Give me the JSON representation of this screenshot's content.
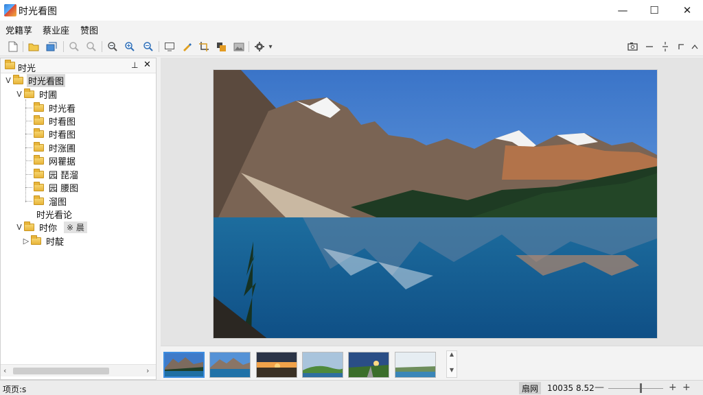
{
  "app": {
    "title": "时光看图"
  },
  "window_controls": {
    "minimize": "—",
    "maximize": "☐",
    "close": "✕"
  },
  "menu": [
    "党籍莩",
    "蔡业座",
    "赞图"
  ],
  "toolbar": {
    "icons": [
      "new-file-icon",
      "open-folder-icon",
      "open-3d-icon",
      "zoom-icon",
      "search-icon",
      "zoom-out-icon",
      "zoom-in-icon",
      "zoom-fit-icon",
      "fit-window-icon",
      "pen-icon",
      "crop-icon",
      "color-icon",
      "gallery-icon",
      "settings-icon"
    ],
    "dropdown": "▾",
    "right_icons": [
      "screenshot-icon",
      "minus-icon",
      "split-icon",
      "corner-icon",
      "collapse-icon"
    ]
  },
  "panel": {
    "title": "时光",
    "pin": "⊥",
    "close": "✕"
  },
  "tree": {
    "root": {
      "toggle": "V",
      "label": "时光看图"
    },
    "folder1": {
      "toggle": "V",
      "label": "时圃"
    },
    "children": [
      "时光看",
      "时看图",
      "时看图",
      "时涨圃",
      "网瞿据",
      "园 琵溜",
      "园 腰图",
      "溜图"
    ],
    "loose_item": "时光看论",
    "folder2": {
      "toggle": "V",
      "label": "时你",
      "tag": "※ 晨"
    },
    "folder3": {
      "toggle": "▷",
      "label": "时靛"
    }
  },
  "scrollbar": {
    "left": "‹",
    "right": "›"
  },
  "filmstrip": {
    "scroll_up": "▲",
    "scroll_down": "▼",
    "thumbnails": [
      "mountain-lake",
      "mountain-lake-2",
      "sunset",
      "green-hills",
      "sunrise-road",
      "lake-view"
    ],
    "active_index": 0
  },
  "status": {
    "left": "项页:s",
    "badge": "扇网",
    "size": "10035 8.52",
    "zoom_minus": "—",
    "zoom_plus": "+",
    "zoom_plus2": "+",
    "zoom_level": 0.58
  }
}
